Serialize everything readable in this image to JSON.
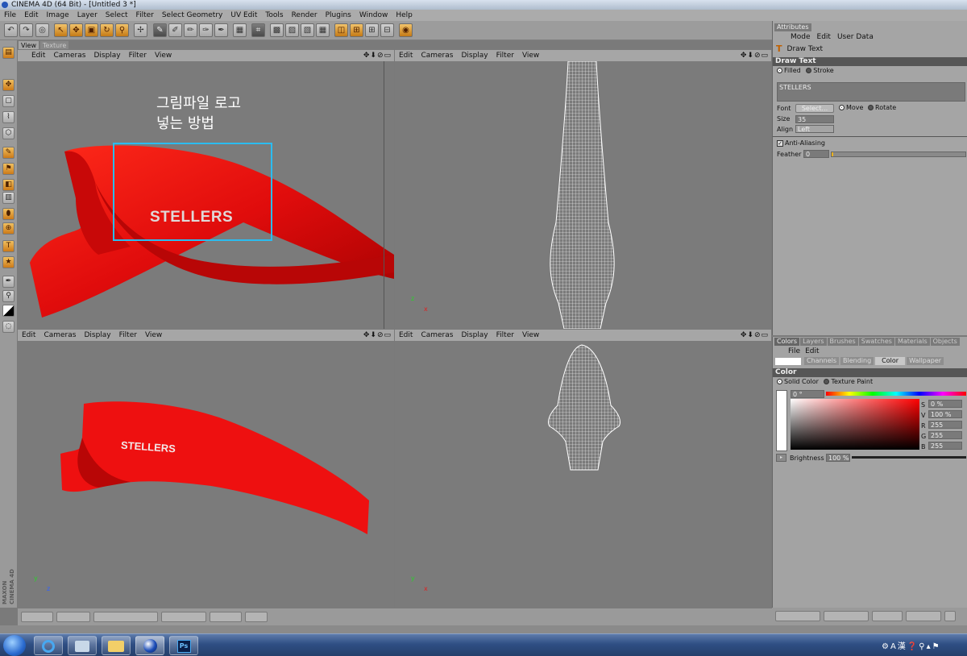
{
  "window": {
    "title": "CINEMA 4D (64 Bit) - [Untitled 3 *]"
  },
  "menu": [
    "File",
    "Edit",
    "Image",
    "Layer",
    "Select",
    "Filter",
    "Select Geometry",
    "UV Edit",
    "Tools",
    "Render",
    "Plugins",
    "Window",
    "Help"
  ],
  "viewport_tabs": [
    "View",
    "Texture"
  ],
  "viewport_menu": [
    "Edit",
    "Cameras",
    "Display",
    "Filter",
    "View"
  ],
  "viewport_controls": "✥⬇⊘▭",
  "annotation": {
    "line1": "그림파일 로고",
    "line2": "넣는 방법"
  },
  "logo_text": "STELLERS",
  "axes": {
    "y": "y",
    "x": "x",
    "z": "z"
  },
  "attributes": {
    "panel_title": "Attributes",
    "menu": [
      "Mode",
      "Edit",
      "User Data"
    ],
    "tool_name": "Draw Text",
    "section": "Draw Text",
    "fill_filled": "Filled",
    "fill_stroke": "Stroke",
    "text_value": "STELLERS",
    "font_label": "Font",
    "font_button": "Select...",
    "size_label": "Size",
    "size_value": "35",
    "align_label": "Align",
    "align_value": "Left",
    "move_label": "Move",
    "rotate_label": "Rotate",
    "antialias_label": "Anti-Aliasing",
    "feather_label": "Feather",
    "feather_value": "0"
  },
  "colors_panel": {
    "tabs": [
      "Colors",
      "Layers",
      "Brushes",
      "Swatches",
      "Materials",
      "Objects"
    ],
    "menu": [
      "File",
      "Edit"
    ],
    "subtabs": [
      "Channels",
      "Blending",
      "Color",
      "Wallpaper"
    ],
    "section": "Color",
    "mode_solid": "Solid Color",
    "mode_texture": "Texture Paint",
    "hue_value": "0 °",
    "s_label": "S",
    "s_value": "0 %",
    "v_label": "V",
    "v_value": "100 %",
    "r_label": "R",
    "r_value": "255",
    "g_label": "G",
    "g_value": "255",
    "b_label": "B",
    "b_value": "255",
    "brightness_label": "Brightness",
    "brightness_value": "100 %"
  },
  "maxon_logo": "MAXON CINEMA 4D",
  "colors": {
    "model_red": "#e01010",
    "annotation_box": "#2bbcf0",
    "wireframe": "#ffffff"
  }
}
